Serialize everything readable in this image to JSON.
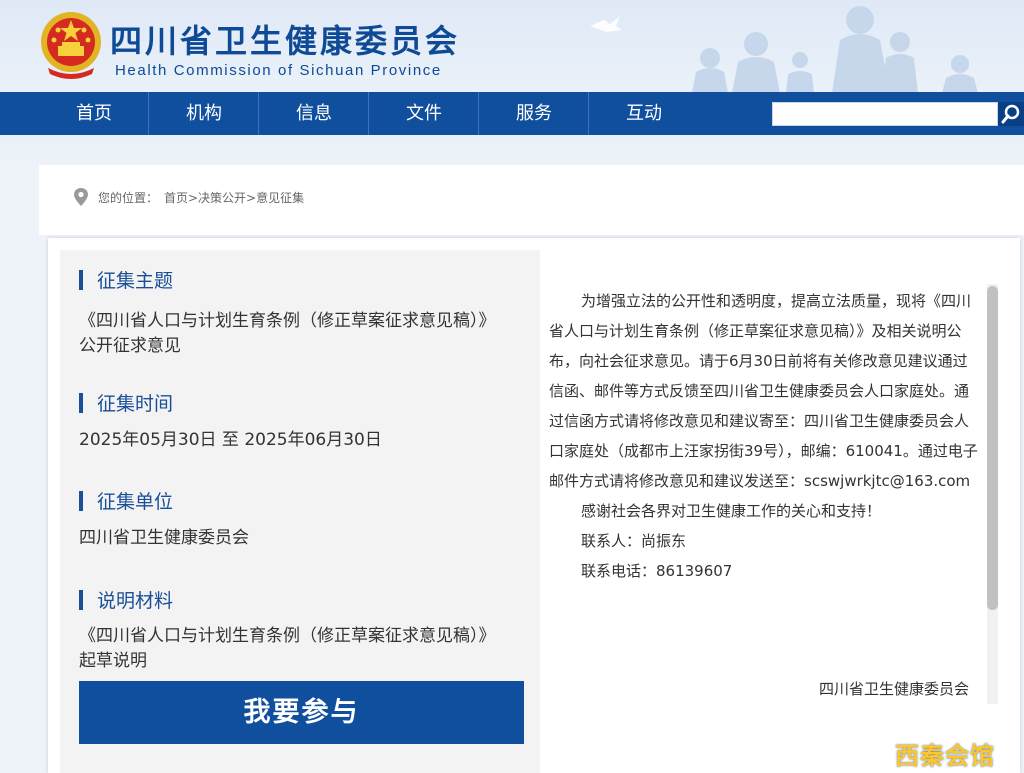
{
  "header": {
    "title": "四川省卫生健康委员会",
    "subtitle": "Health Commission of Sichuan Province"
  },
  "nav": {
    "items": [
      {
        "label": "首页"
      },
      {
        "label": "机构"
      },
      {
        "label": "信息"
      },
      {
        "label": "文件"
      },
      {
        "label": "服务"
      },
      {
        "label": "互动"
      }
    ],
    "search_value": ""
  },
  "breadcrumb": {
    "label": "您的位置：",
    "path": "首页>决策公开>意见征集"
  },
  "left": {
    "topic_title": "征集主题",
    "topic_text": "《四川省人口与计划生育条例（修正草案征求意见稿）》公开征求意见",
    "time_title": "征集时间",
    "time_text": "2025年05月30日 至 2025年06月30日",
    "unit_title": "征集单位",
    "unit_text": "四川省卫生健康委员会",
    "material_title": "说明材料",
    "material_text": "《四川省人口与计划生育条例（修正草案征求意见稿）》起草说明",
    "join_label": "我要参与"
  },
  "content": {
    "para1": "为增强立法的公开性和透明度，提高立法质量，现将《四川省人口与计划生育条例（修正草案征求意见稿）》及相关说明公布，向社会征求意见。请于6月30日前将有关修改意见建议通过信函、邮件等方式反馈至四川省卫生健康委员会人口家庭处。通过信函方式请将修改意见和建议寄至：四川省卫生健康委员会人口家庭处（成都市上汪家拐街39号），邮编：610041。通过电子邮件方式请将修改意见和建议发送至：scswjwrkjtc@163.com",
    "thanks": "感谢社会各界对卫生健康工作的关心和支持！",
    "contact_person": "联系人：尚振东",
    "contact_phone": "联系电话：86139607",
    "signature": "四川省卫生健康委员会"
  },
  "watermark": "西秦会馆",
  "colors": {
    "primary": "#0f4f9e",
    "title_blue": "#1a4f97",
    "panel_gray": "#f3f3f3"
  }
}
